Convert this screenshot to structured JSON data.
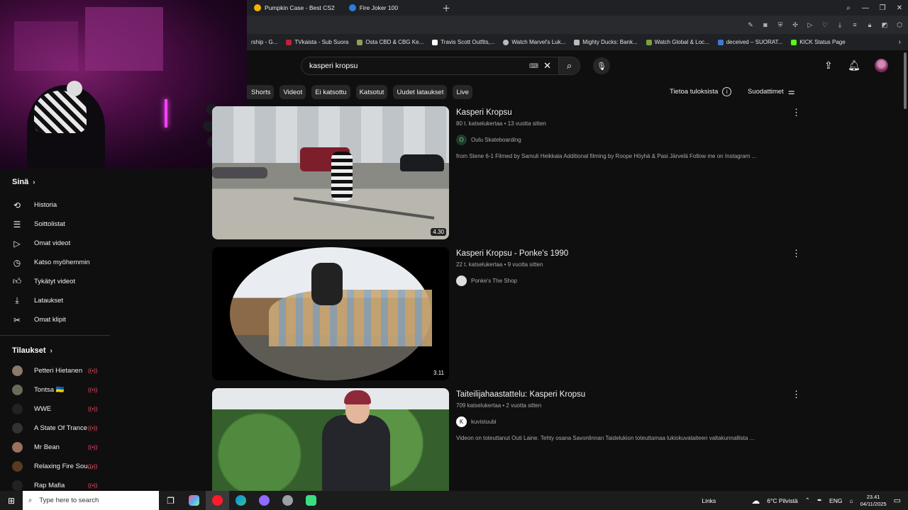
{
  "browser": {
    "tabs": [
      {
        "label": "Pumpkin Case - Best CS2",
        "color": "#f5b400"
      },
      {
        "label": "Fire Joker 100",
        "color": "#2a7de1"
      }
    ],
    "new_tab_icon": "plus-icon",
    "bookmarks": [
      {
        "label": "rship - G...",
        "color": "#7a7a7a"
      },
      {
        "label": "TVkaista - Sub Suora",
        "color": "#c0203a"
      },
      {
        "label": "Osta CBD & CBG Ke...",
        "color": "#8aa060"
      },
      {
        "label": "Travis Scott Outfits,...",
        "color": "#ffffff"
      },
      {
        "label": "Watch Marvel's Luk...",
        "color": "#bbbbbb"
      },
      {
        "label": "Mighty Ducks: Bank...",
        "color": "#bbbbbb"
      },
      {
        "label": "Watch Global & Loc...",
        "color": "#7da03d"
      },
      {
        "label": "deceived – SUORAT...",
        "color": "#3b7bd4"
      },
      {
        "label": "KICK Status Page",
        "color": "#53fc18"
      }
    ]
  },
  "youtube": {
    "search": {
      "value": "kasperi kropsu"
    },
    "chips": [
      "Shorts",
      "Videot",
      "Ei katsottu",
      "Katsotut",
      "Uudet lataukset",
      "Live"
    ],
    "info_link": "Tietoa tuloksista",
    "filters": "Suodattimet",
    "sidebar": {
      "you_header": "Sinä",
      "you_items": [
        {
          "label": "Historia",
          "icon": "history-icon",
          "glyph": "⟲"
        },
        {
          "label": "Soittolistat",
          "icon": "playlists-icon",
          "glyph": "☰"
        },
        {
          "label": "Omat videot",
          "icon": "your-videos-icon",
          "glyph": "▷"
        },
        {
          "label": "Katso myöhemmin",
          "icon": "watch-later-icon",
          "glyph": "◷"
        },
        {
          "label": "Tykätyt videot",
          "icon": "liked-videos-icon",
          "glyph": "👍"
        },
        {
          "label": "Lataukset",
          "icon": "downloads-icon",
          "glyph": "⤓"
        },
        {
          "label": "Omat klipit",
          "icon": "clips-icon",
          "glyph": "✂"
        }
      ],
      "subs_header": "Tilaukset",
      "subscriptions": [
        {
          "label": "Petteri Hietanen",
          "color": "#8a7a6a"
        },
        {
          "label": "Tontsa 🇺🇦",
          "color": "#6a6a5a"
        },
        {
          "label": "WWE",
          "color": "#222222"
        },
        {
          "label": "A State Of Trance",
          "color": "#333333"
        },
        {
          "label": "Mr Bean",
          "color": "#9a7060"
        },
        {
          "label": "Relaxing Fire Sou...",
          "color": "#5a3a20"
        },
        {
          "label": "Rap Mafia",
          "color": "#222222"
        }
      ],
      "live_indicator": "((•))"
    },
    "results": [
      {
        "title": "Kasperi Kropsu",
        "stats": "80 t. katselukertaa • 13 vuotta sitten",
        "channel": "Oulu Skateboarding",
        "channel_initial": "O",
        "description": "from Stene 6-1 Filmed by Samuli Heikkala Additional filming by Roope Höyhä & Pasi Järvelä Follow me on Instagram ...",
        "duration": "4.30"
      },
      {
        "title": "Kasperi Kropsu - Ponke's 1990",
        "stats": "22 t. katselukertaa • 9 vuotta sitten",
        "channel": "Ponke's The Shop",
        "channel_initial": "",
        "description": "",
        "duration": "3.11"
      },
      {
        "title": "Taiteilijahaastattelu: Kasperi Kropsu",
        "stats": "709 katselukertaa • 2 vuotta sitten",
        "channel": "kuvistuubi",
        "channel_initial": "K",
        "description": "Videon on toteuttanut Outi Laine. Tehty osana Savonlinnan Taidelukion toteuttamaa lukiokuvataiteen valtakunnallista ...",
        "duration": ""
      }
    ]
  },
  "taskbar": {
    "search_placeholder": "Type here to search",
    "links": "Links",
    "weather": "6°C Pilvistä",
    "lang": "ENG",
    "time": "23.41",
    "date": "04/11/2025"
  }
}
